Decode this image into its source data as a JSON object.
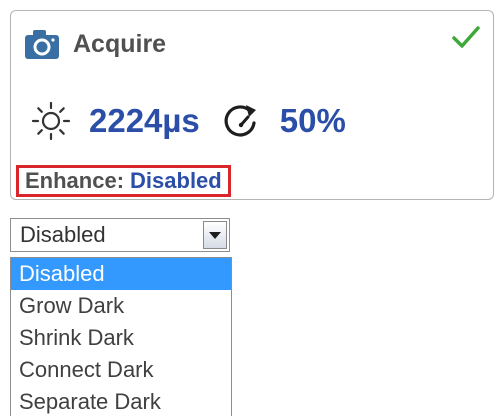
{
  "card": {
    "title": "Acquire",
    "title_icon": "camera-icon",
    "status_icon": "checkmark-icon",
    "exposure": "2224µs",
    "exposure_icon": "sun-icon",
    "gain": "50%",
    "gain_icon": "gain-dial-icon",
    "enhance_label": "Enhance:",
    "enhance_value": "Disabled"
  },
  "dropdown": {
    "selected": "Disabled",
    "arrow_icon": "chevron-down-icon",
    "options": [
      {
        "label": "Disabled",
        "highlighted": true
      },
      {
        "label": "Grow Dark",
        "highlighted": false
      },
      {
        "label": "Shrink Dark",
        "highlighted": false
      },
      {
        "label": "Connect Dark",
        "highlighted": false
      },
      {
        "label": "Separate Dark",
        "highlighted": false
      }
    ]
  },
  "colors": {
    "accent_blue": "#2b4ea8",
    "highlight_red": "#d9262c",
    "check_green": "#3fa83a",
    "selection_blue": "#3399ff"
  }
}
